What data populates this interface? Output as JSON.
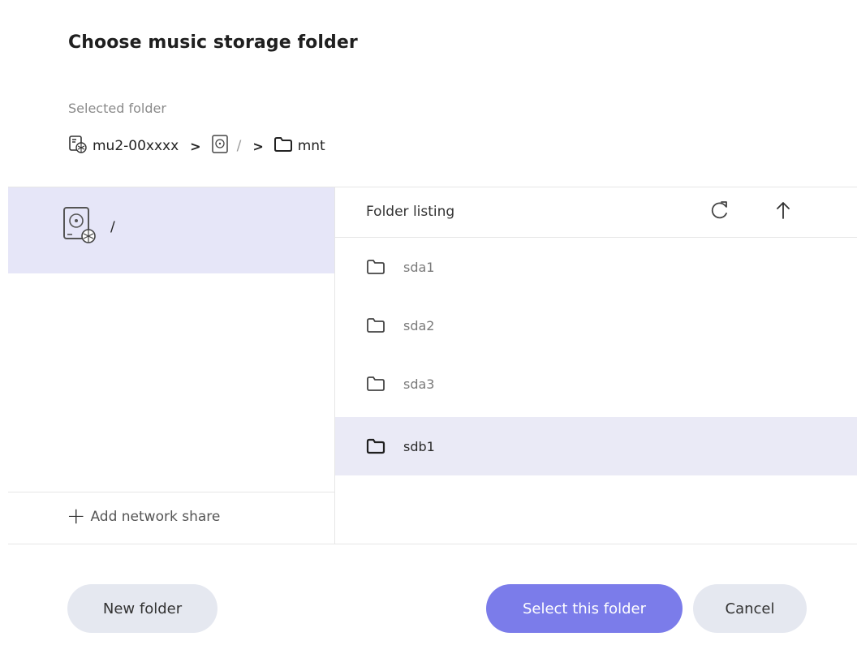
{
  "dialog": {
    "title": "Choose music storage folder",
    "selected_label": "Selected folder"
  },
  "breadcrumb": {
    "items": [
      {
        "label": "mu2-00xxxx",
        "icon": "network-drive-icon"
      },
      {
        "label": "/",
        "icon": "disk-icon"
      },
      {
        "label": "mnt",
        "icon": "folder-icon"
      }
    ],
    "separator": ">"
  },
  "left_pane": {
    "drives": [
      {
        "label": "/",
        "icon": "hard-drive-icon",
        "selected": true
      }
    ],
    "add_share_label": "Add network share"
  },
  "listing": {
    "title": "Folder listing",
    "refresh_icon": "refresh-icon",
    "up_icon": "arrow-up-icon",
    "folders": [
      {
        "name": "sda1",
        "selected": false
      },
      {
        "name": "sda2",
        "selected": false
      },
      {
        "name": "sda3",
        "selected": false
      },
      {
        "name": "sdb1",
        "selected": true
      }
    ]
  },
  "buttons": {
    "new_folder": "New folder",
    "select_folder": "Select this folder",
    "cancel": "Cancel"
  },
  "colors": {
    "accent": "#7b7cea",
    "selection": "#e6e6f8",
    "secondary_button": "#e5e8f0"
  }
}
